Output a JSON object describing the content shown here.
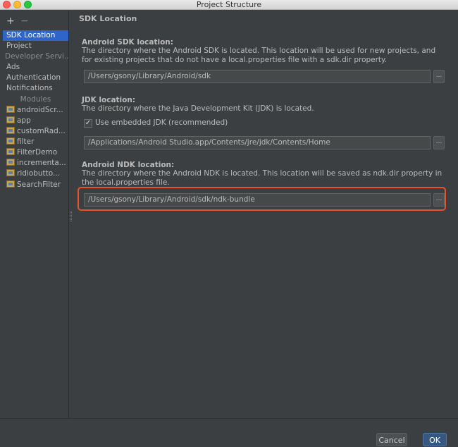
{
  "window": {
    "title": "Project Structure"
  },
  "toolbar": {
    "add": "+",
    "remove": "−"
  },
  "sidebar": {
    "items": [
      "SDK Location",
      "Project"
    ],
    "developer_services_header": "Developer Servi...",
    "developer_services": [
      "Ads",
      "Authentication",
      "Notifications"
    ],
    "modules_header": "Modules",
    "modules": [
      "androidScr...",
      "app",
      "customRad...",
      "filter",
      "FilterDemo",
      "incrementa...",
      "ridiobutto...",
      "SearchFilter"
    ]
  },
  "main": {
    "title": "SDK Location",
    "sdk": {
      "heading": "Android SDK location:",
      "description": "The directory where the Android SDK is located. This location will be used for new projects, and for existing projects that do not have a local.properties file with a sdk.dir property.",
      "path": "/Users/gsony/Library/Android/sdk",
      "browse": "..."
    },
    "jdk": {
      "heading": "JDK location:",
      "description": "The directory where the Java Development Kit (JDK) is located.",
      "checkbox_label": "Use embedded JDK (recommended)",
      "checkbox_mark": "✓",
      "path": "/Applications/Android Studio.app/Contents/jre/jdk/Contents/Home",
      "browse": "..."
    },
    "ndk": {
      "heading": "Android NDK location:",
      "description": "The directory where the Android NDK is located. This location will be saved as ndk.dir property in the local.properties file.",
      "path": "/Users/gsony/Library/Android/sdk/ndk-bundle",
      "browse": "..."
    }
  },
  "buttons": {
    "cancel": "Cancel",
    "ok": "OK"
  },
  "colors": {
    "accent": "#2f65ca",
    "highlight": "#e5542f",
    "background": "#3c3f41"
  }
}
